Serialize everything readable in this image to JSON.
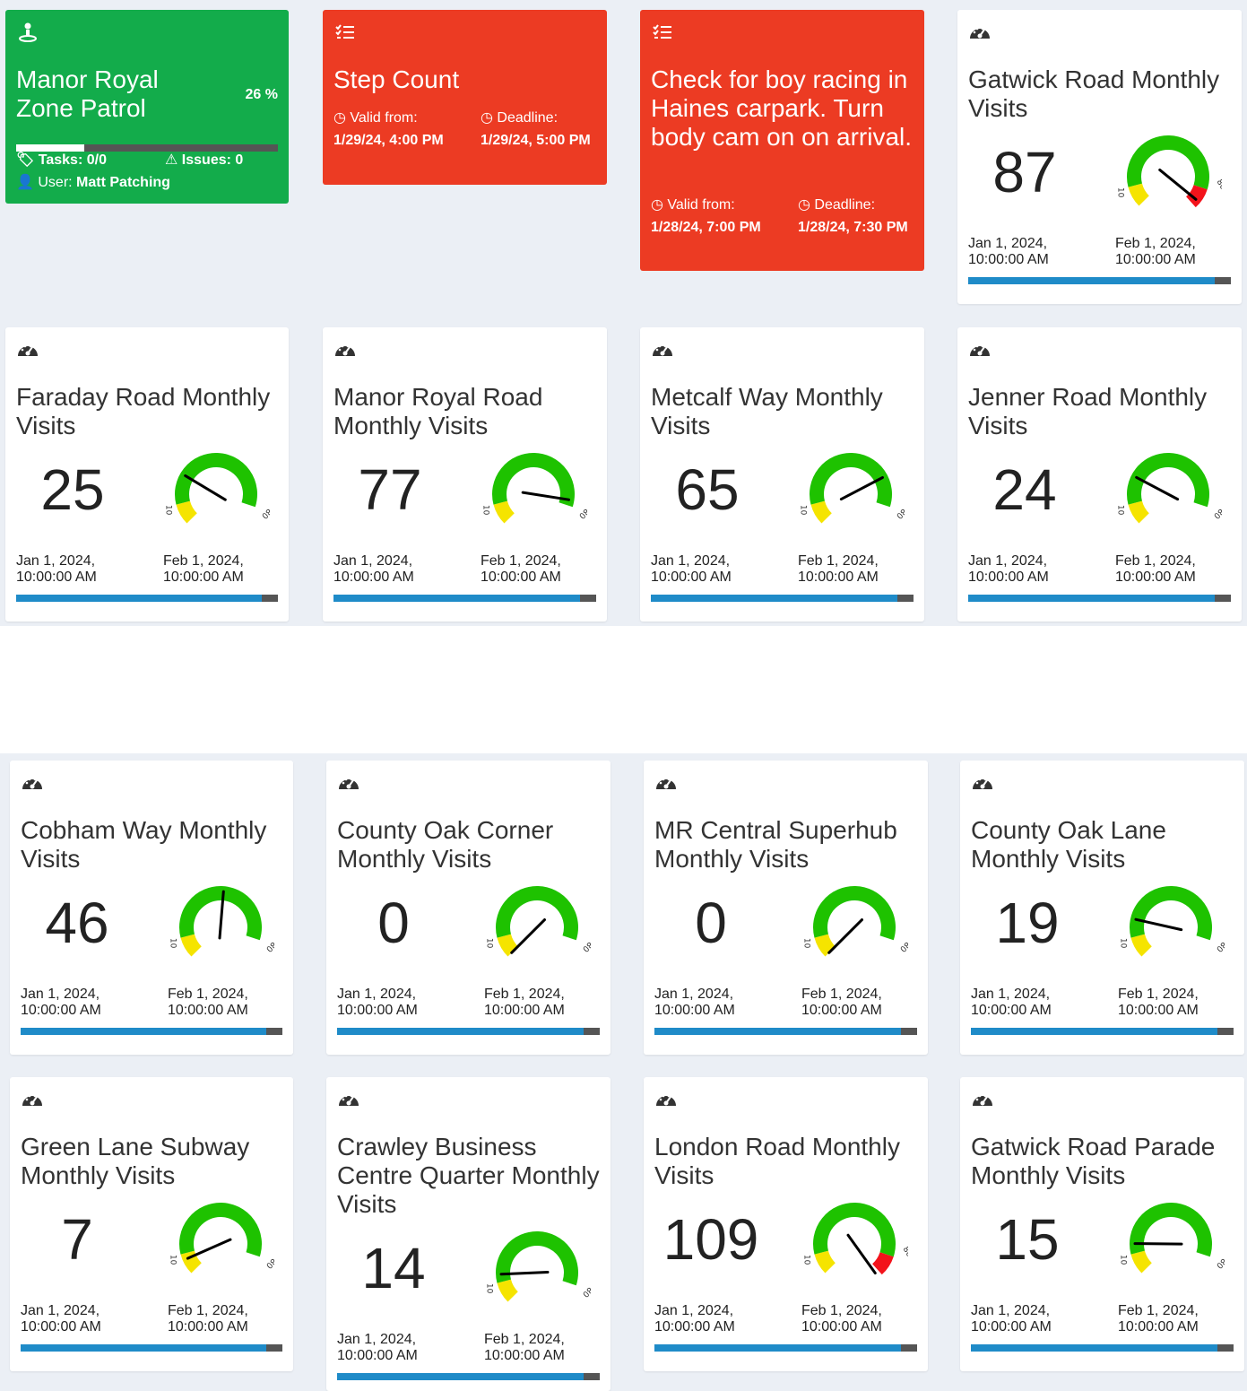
{
  "colors": {
    "green": "#13ac4b",
    "red": "#ec3b23",
    "gauge_green": "#1ec200",
    "gauge_yellow": "#f5e400",
    "gauge_red": "#f3131b",
    "bar_blue": "#1f8bc8",
    "bar_gray": "#555555"
  },
  "patrol": {
    "icon": "person-pin-icon",
    "title": "Manor Royal Zone Patrol",
    "percent": "26 %",
    "progress": 0.26,
    "tasks": "Tasks: 0/0",
    "issues": "Issues: 0",
    "user_label": "User: ",
    "user_name": "Matt Patching"
  },
  "tasks": [
    {
      "icon": "checklist-icon",
      "title": "Step Count",
      "valid_label": "Valid from:",
      "valid_value": "1/29/24, 4:00 PM",
      "deadline_label": "Deadline:",
      "deadline_value": "1/29/24, 5:00 PM"
    },
    {
      "icon": "checklist-icon",
      "title": "Check for boy racing in Haines carpark. Turn body cam on on arrival.",
      "valid_label": "Valid from:",
      "valid_value": "1/28/24, 7:00 PM",
      "deadline_label": "Deadline:",
      "deadline_value": "1/28/24, 7:30 PM"
    }
  ],
  "gauge_scale": {
    "min_label": "10",
    "max_label": "80"
  },
  "meters": [
    {
      "title": "Gatwick Road Monthly Visits",
      "value": "87",
      "needle": 87,
      "start": "Jan 1, 2024, 10:00:00 AM",
      "end": "Feb 1, 2024, 10:00:00 AM",
      "progress": 0.94
    },
    {
      "title": "Faraday Road Monthly Visits",
      "value": "25",
      "needle": 25,
      "start": "Jan 1, 2024, 10:00:00 AM",
      "end": "Feb 1, 2024, 10:00:00 AM",
      "progress": 0.94
    },
    {
      "title": "Manor Royal Road Monthly Visits",
      "value": "77",
      "needle": 77,
      "start": "Jan 1, 2024, 10:00:00 AM",
      "end": "Feb 1, 2024, 10:00:00 AM",
      "progress": 0.94
    },
    {
      "title": "Metcalf Way Monthly Visits",
      "value": "65",
      "needle": 65,
      "start": "Jan 1, 2024, 10:00:00 AM",
      "end": "Feb 1, 2024, 10:00:00 AM",
      "progress": 0.94
    },
    {
      "title": "Jenner Road Monthly Visits",
      "value": "24",
      "needle": 24,
      "start": "Jan 1, 2024, 10:00:00 AM",
      "end": "Feb 1, 2024, 10:00:00 AM",
      "progress": 0.94
    },
    {
      "title": "Cobham Way Monthly Visits",
      "value": "46",
      "needle": 46,
      "start": "Jan 1, 2024, 10:00:00 AM",
      "end": "Feb 1, 2024, 10:00:00 AM",
      "progress": 0.94
    },
    {
      "title": "County Oak Corner Monthly Visits",
      "value": "0",
      "needle": 0,
      "start": "Jan 1, 2024, 10:00:00 AM",
      "end": "Feb 1, 2024, 10:00:00 AM",
      "progress": 0.94
    },
    {
      "title": "MR Central Superhub Monthly Visits",
      "value": "0",
      "needle": 0,
      "start": "Jan 1, 2024, 10:00:00 AM",
      "end": "Feb 1, 2024, 10:00:00 AM",
      "progress": 0.94
    },
    {
      "title": "County Oak Lane Monthly Visits",
      "value": "19",
      "needle": 19,
      "start": "Jan 1, 2024, 10:00:00 AM",
      "end": "Feb 1, 2024, 10:00:00 AM",
      "progress": 0.94
    },
    {
      "title": "Green Lane Subway Monthly Visits",
      "value": "7",
      "needle": 7,
      "start": "Jan 1, 2024, 10:00:00 AM",
      "end": "Feb 1, 2024, 10:00:00 AM",
      "progress": 0.94
    },
    {
      "title": "Crawley Business Centre Quarter Monthly Visits",
      "value": "14",
      "needle": 14,
      "start": "Jan 1, 2024, 10:00:00 AM",
      "end": "Feb 1, 2024, 10:00:00 AM",
      "progress": 0.94
    },
    {
      "title": "London Road Monthly Visits",
      "value": "109",
      "needle": 109,
      "start": "Jan 1, 2024, 10:00:00 AM",
      "end": "Feb 1, 2024, 10:00:00 AM",
      "progress": 0.94
    },
    {
      "title": "Gatwick Road Parade Monthly Visits",
      "value": "15",
      "needle": 15,
      "start": "Jan 1, 2024, 10:00:00 AM",
      "end": "Feb 1, 2024, 10:00:00 AM",
      "progress": 0.94
    }
  ]
}
